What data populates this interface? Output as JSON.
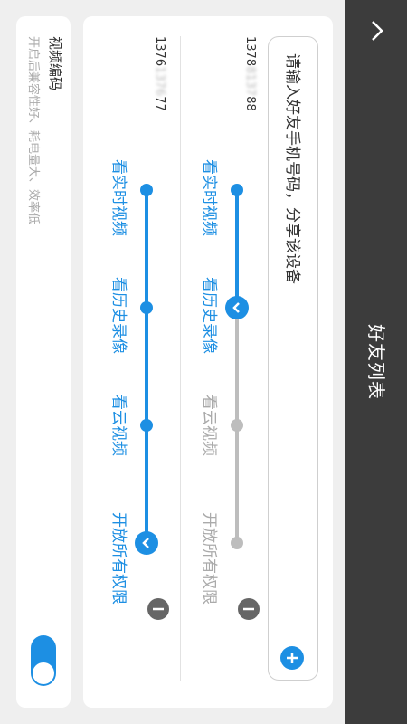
{
  "header": {
    "title": "好友列表"
  },
  "share": {
    "placeholder": "请输入好友手机号码，分享该设备"
  },
  "levels": [
    "看实时视频",
    "看历史录像",
    "看云视频",
    "开放所有权限"
  ],
  "friends": [
    {
      "phone_prefix": "1378",
      "phone_masked": "8137",
      "phone_suffix": "88",
      "level": 2
    },
    {
      "phone_prefix": "1376",
      "phone_masked": "1376",
      "phone_suffix": "77",
      "level": 4
    }
  ],
  "video_codec": {
    "title": "视频编码",
    "desc": "开启后兼容性好、耗电量大、效率低",
    "enabled": true
  },
  "colors": {
    "accent": "#1d8fe3",
    "inactive": "#aaaaaa",
    "header": "#3c3c3c"
  }
}
